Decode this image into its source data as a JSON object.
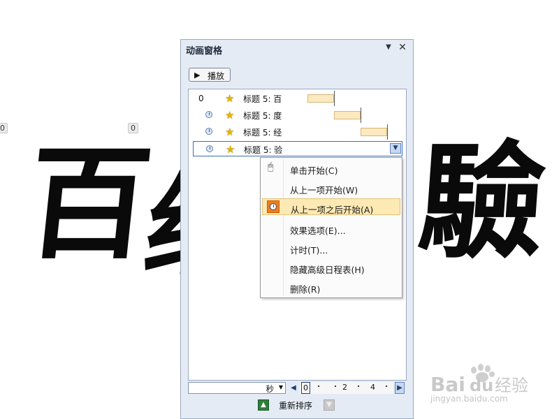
{
  "slide": {
    "chars": [
      "百",
      "经",
      "驗"
    ],
    "badge_left": "0",
    "badge_mid": "0"
  },
  "pane": {
    "title": "动画窗格",
    "menu_icon": "▼",
    "close_icon": "✕",
    "play_label": "播放",
    "rows": [
      {
        "prefix": "0",
        "name": "标题 5: 百",
        "icon": "star-effect-icon"
      },
      {
        "name": "标题 5: 度",
        "icon": "star-effect-icon"
      },
      {
        "name": "标题 5: 经",
        "icon": "star-effect-icon"
      },
      {
        "name": "标题 5: 验",
        "icon": "star-effect-icon"
      }
    ]
  },
  "context_menu": {
    "items": [
      {
        "label": "单击开始(C)",
        "icon": "mouse-icon"
      },
      {
        "label": "从上一项开始(W)"
      },
      {
        "label": "从上一项之后开始(A)",
        "icon": "clock-icon",
        "selected": true
      },
      {
        "label": "效果选项(E)..."
      },
      {
        "label": "计时(T)..."
      },
      {
        "label": "隐藏高级日程表(H)"
      },
      {
        "label": "删除(R)"
      }
    ]
  },
  "timeline": {
    "unit": "秒",
    "ticks": [
      "0",
      "2",
      "4"
    ]
  },
  "reorder": {
    "label": "重新排序"
  },
  "watermark": {
    "logo": "Bai du 经验",
    "url": "jingyan.baidu.com"
  },
  "colors": {
    "pane_bg": "#e4ebf5",
    "bar_fill": "#fde9bf",
    "menu_highlight": "#fde9b3",
    "clock_orange": "#f07e1c"
  }
}
